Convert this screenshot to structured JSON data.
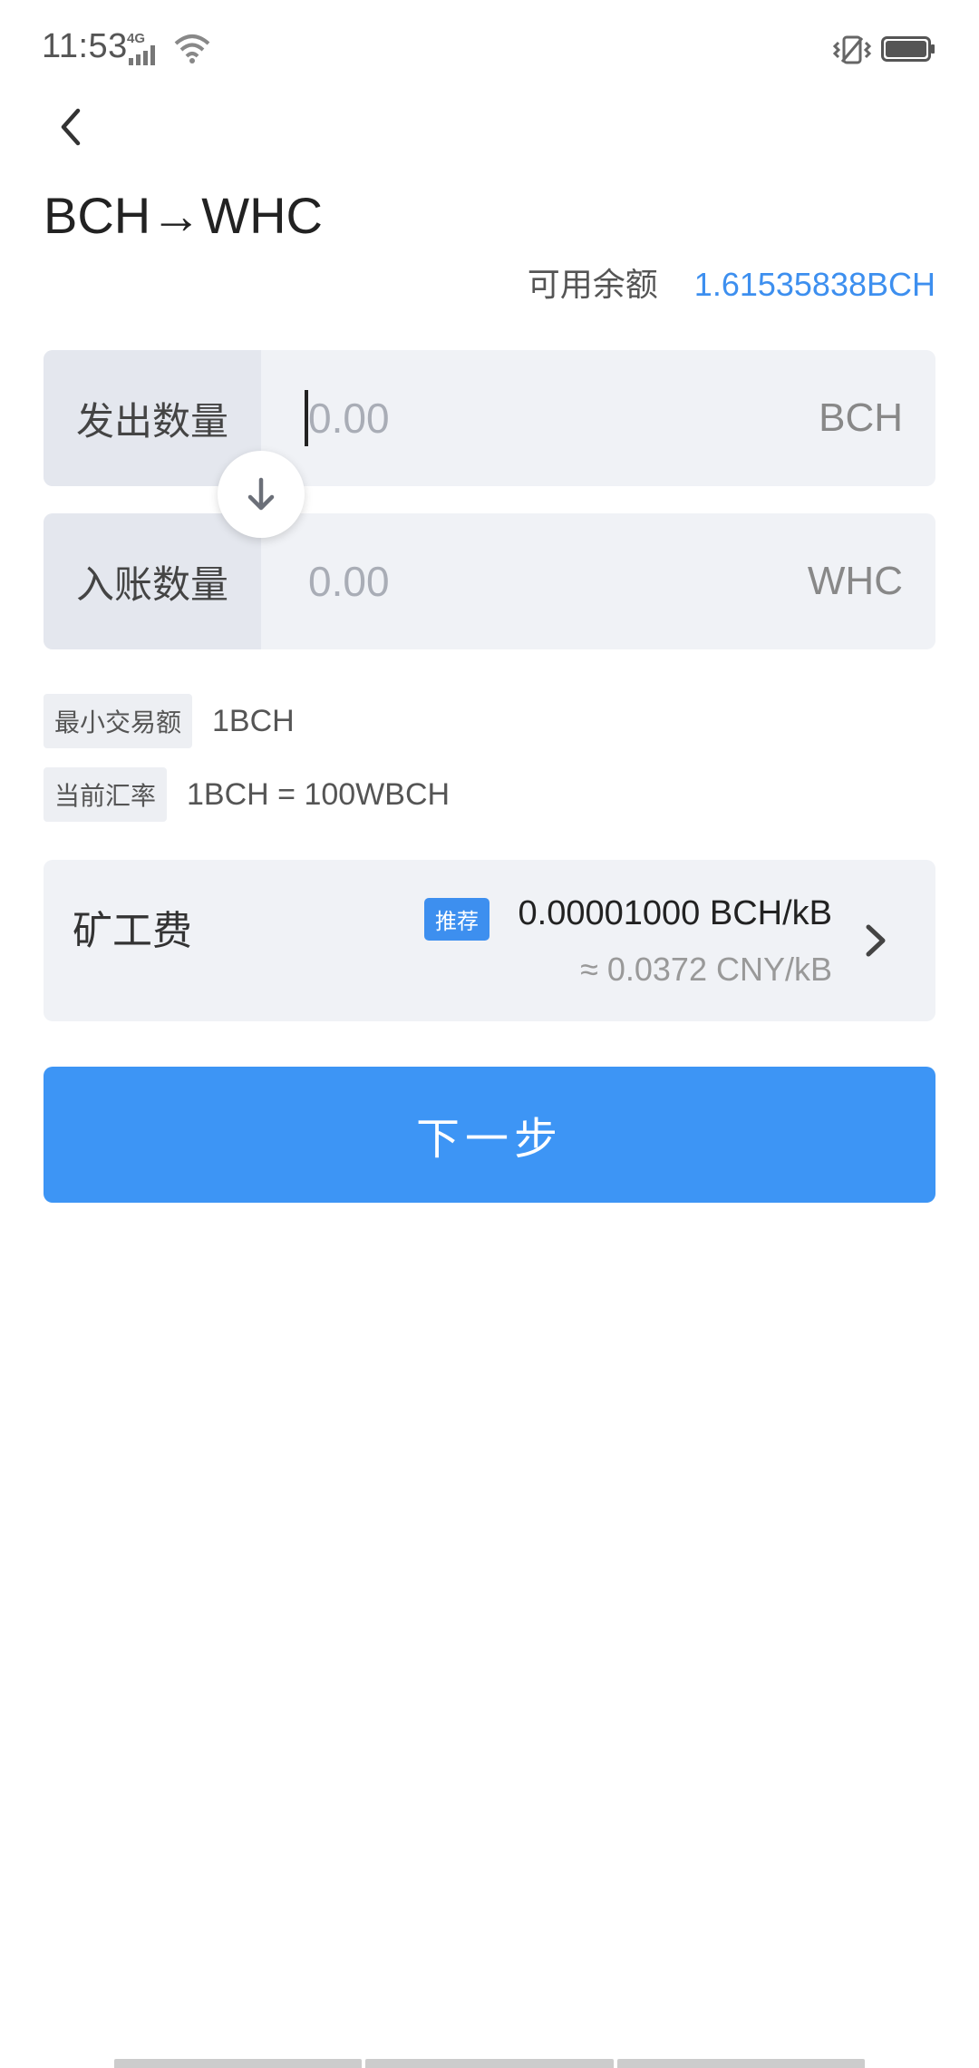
{
  "status_bar": {
    "time": "11:53",
    "network": "4G"
  },
  "header": {
    "back_icon": "chevron-left-icon",
    "title": "BCH→WHC"
  },
  "balance": {
    "label": "可用余额",
    "value": "1.61535838BCH",
    "color": "#3d8fef"
  },
  "send": {
    "label": "发出数量",
    "placeholder": "0.00",
    "value": "",
    "unit": "BCH"
  },
  "swap": {
    "icon": "arrow-down-icon"
  },
  "receive": {
    "label": "入账数量",
    "placeholder": "0.00",
    "value": "",
    "unit": "WHC"
  },
  "info": {
    "min_label": "最小交易额",
    "min_value": "1BCH",
    "rate_label": "当前汇率",
    "rate_value": "1BCH = 100WBCH"
  },
  "fee": {
    "label": "矿工费",
    "badge": "推荐",
    "value": "0.00001000 BCH/kB",
    "approx": "≈ 0.0372 CNY/kB",
    "chevron_icon": "chevron-right-icon"
  },
  "actions": {
    "next_label": "下一步",
    "button_color": "#3d95f5"
  }
}
